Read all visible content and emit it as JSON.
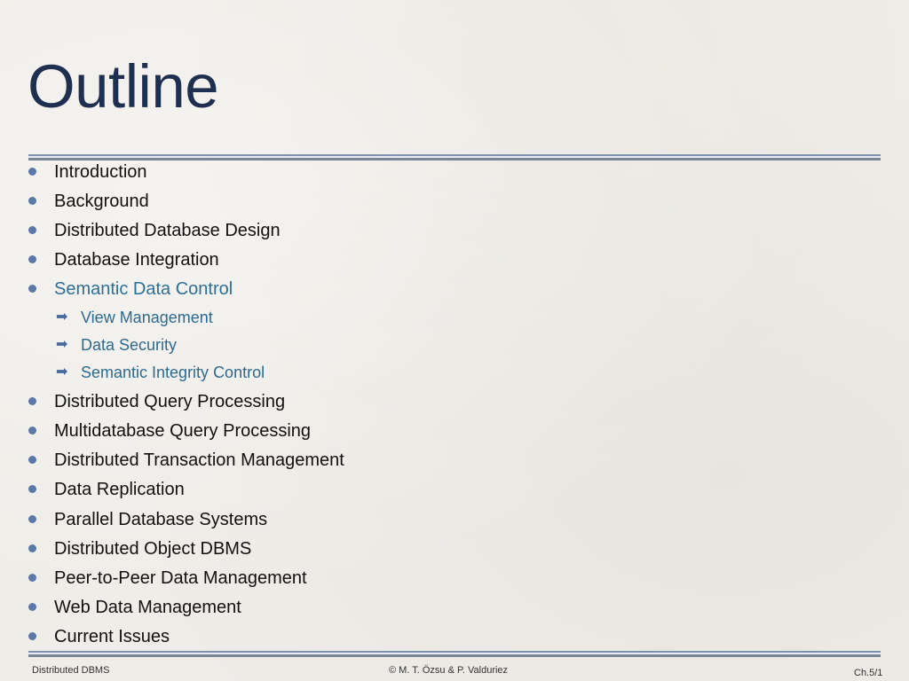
{
  "slide": {
    "title": "Outline",
    "items_top": [
      {
        "label": "Introduction"
      },
      {
        "label": "Background"
      },
      {
        "label": "Distributed Database Design"
      },
      {
        "label": "Database Integration"
      },
      {
        "label": "Semantic Data Control",
        "highlighted": true
      }
    ],
    "subitems": [
      {
        "icon": "arrow-right-icon",
        "glyph": "➡",
        "label": "View Management"
      },
      {
        "icon": "arrow-right-icon",
        "glyph": "➡",
        "label": "Data Security"
      },
      {
        "icon": "arrow-right-icon",
        "glyph": "➡",
        "label": "Semantic Integrity Control"
      }
    ],
    "items_bottom": [
      {
        "label": "Distributed Query Processing"
      },
      {
        "label": "Multidatabase Query Processing"
      },
      {
        "label": "Distributed Transaction Management"
      },
      {
        "label": "Data Replication"
      },
      {
        "label": "Parallel Database Systems"
      },
      {
        "label": "Distributed Object DBMS"
      },
      {
        "label": "Peer-to-Peer Data Management"
      },
      {
        "label": "Web Data Management"
      },
      {
        "label": "Current Issues"
      }
    ]
  },
  "footer": {
    "left": "Distributed DBMS",
    "center": "© M. T. Özsu & P. Valduriez",
    "right": "Ch.5/1"
  },
  "colors": {
    "title": "#1f2f4f",
    "highlight": "#2f6f96",
    "bullet": "#5a78a8",
    "rule_top": "#7d93b0",
    "rule_bottom": "#7b8595",
    "background": "#efede8"
  }
}
